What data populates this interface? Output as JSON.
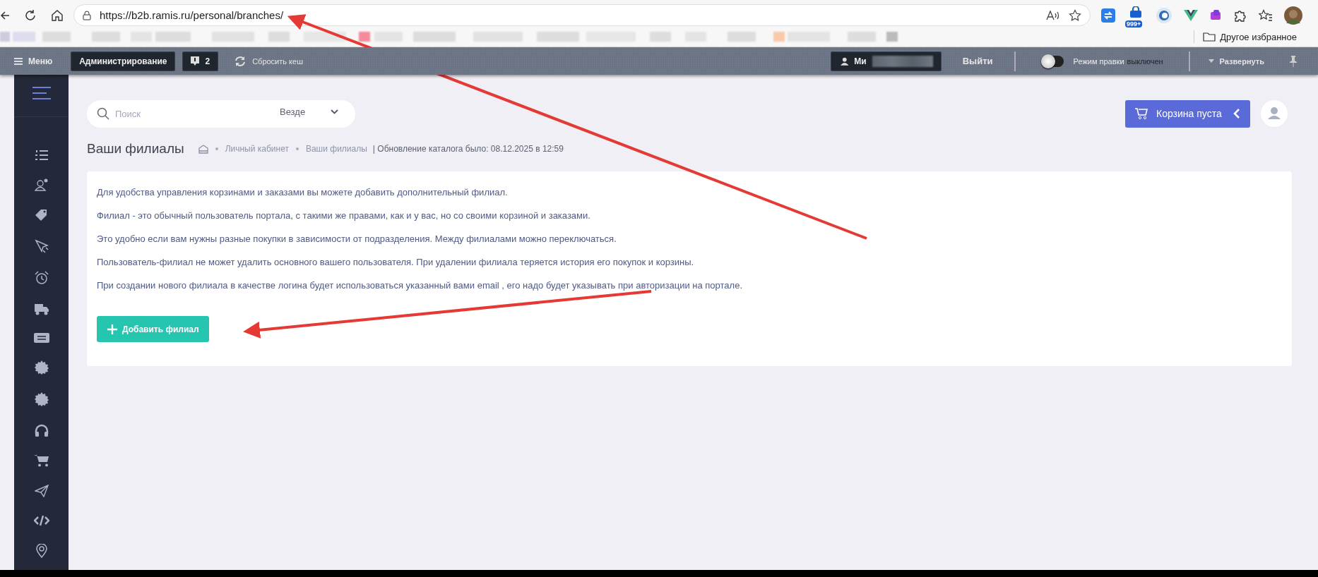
{
  "browser": {
    "url": "https://b2b.ramis.ru/personal/branches/",
    "extension_badge": "999+",
    "bookmark_folder": "Другое избранное"
  },
  "admin_bar": {
    "menu": "Меню",
    "admin_button": "Администрирование",
    "notifications": "2",
    "reset_cache": "Сбросить кеш",
    "user": "Ми",
    "logout": "Выйти",
    "edit_mode": {
      "label": "Режим правки",
      "status": "выключен",
      "on": false
    },
    "expand": "Развернуть"
  },
  "search": {
    "placeholder": "Поиск",
    "scope": "Везде"
  },
  "cart": {
    "label": "Корзина пуста"
  },
  "page": {
    "title": "Ваши филиалы",
    "breadcrumbs": [
      "Личный кабинет",
      "Ваши филиалы"
    ],
    "update_note": "| Обновление каталога было: 08.12.2025 в 12:59"
  },
  "info": [
    "Для удобства управления корзинами и заказами вы можете добавить дополнительный филиал.",
    "Филиал - это обычный пользователь портала, с такими же правами, как и у вас, но со своими корзиной и заказами.",
    "Это удобно если вам нужны разные покупки в зависимости от подразделения. Между филиалами можно переключаться.",
    "Пользователь-филиал не может удалить основного вашего пользователя. При удалении филиала теряется история его покупок и корзины.",
    "При создании нового филиала в качестве логина будет использоваться указанный вами email , его надо будет указывать при авторизации на портале."
  ],
  "add_button": "Добавить филиал"
}
